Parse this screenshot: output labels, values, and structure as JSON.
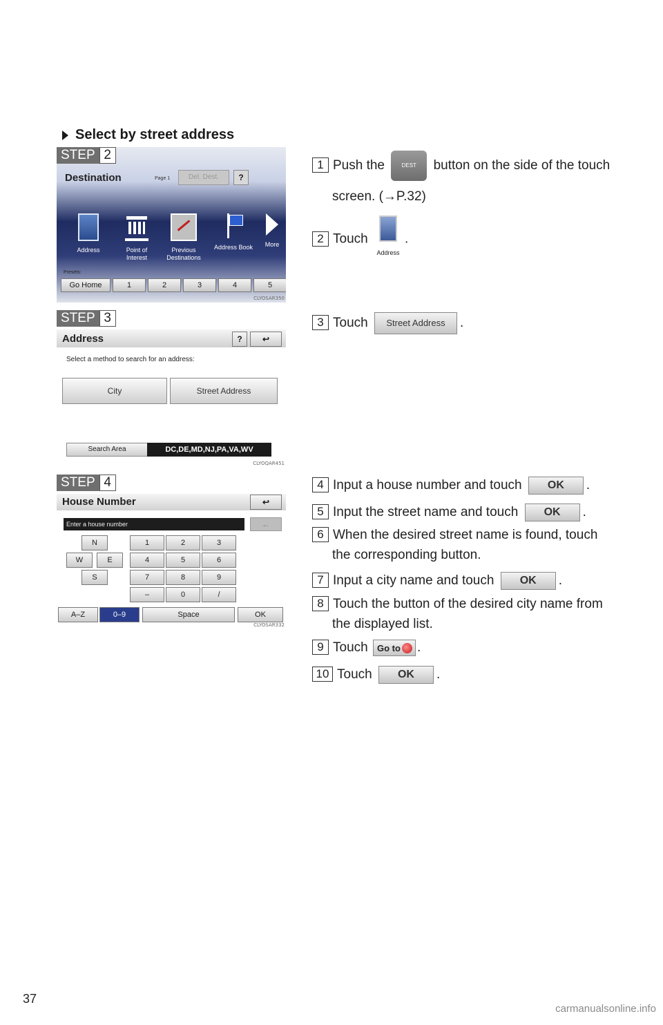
{
  "section_heading": "Select by street address",
  "steps": [
    {
      "step_word": "STEP",
      "step_num": "2"
    },
    {
      "step_word": "STEP",
      "step_num": "3"
    },
    {
      "step_word": "STEP",
      "step_num": "4"
    }
  ],
  "screen_destination": {
    "title": "Destination",
    "page": "Page 1",
    "del_dest": "Del. Dest.",
    "help": "?",
    "icons": [
      {
        "name": "address-icon",
        "label": "Address"
      },
      {
        "name": "poi-icon",
        "label": "Point of Interest"
      },
      {
        "name": "previous-icon",
        "label": "Previous Destinations"
      },
      {
        "name": "address-book-icon",
        "label": "Address Book"
      },
      {
        "name": "more-arrow-icon",
        "label": "More"
      }
    ],
    "presets_label": "Presets:",
    "presets": [
      "Go Home",
      "1",
      "2",
      "3",
      "4",
      "5"
    ],
    "code": "CLYOSAR350"
  },
  "screen_address": {
    "title": "Address",
    "help": "?",
    "back": "↩",
    "prompt": "Select a method to search for an address:",
    "city_btn": "City",
    "street_btn": "Street Address",
    "search_area_btn": "Search Area",
    "search_area_value": "DC,DE,MD,NJ,PA,VA,WV",
    "code": "CLYOQAR451"
  },
  "screen_house": {
    "title": "House Number",
    "back": "↩",
    "input_placeholder": "Enter a house number",
    "backspace": "←",
    "dir_keys": [
      "N",
      "W",
      "E",
      "S"
    ],
    "num_keys": [
      "1",
      "2",
      "3",
      "4",
      "5",
      "6",
      "7",
      "8",
      "9",
      "–",
      "0",
      "/"
    ],
    "bottom_keys": [
      "A–Z",
      "0–9",
      "Space",
      "OK"
    ],
    "code": "CLYOSAR332"
  },
  "instructions": {
    "i1_a": "Push the",
    "i1_dest": "DEST",
    "i1_b": "button on the side of the touch",
    "i1_c": "screen. (→P.32)",
    "i2_a": "Touch",
    "i2_icon_label": "Address",
    "i2_b": ".",
    "i3_a": "Touch",
    "i3_btn": "Street Address",
    "i3_b": ".",
    "i4_a": "Input a house number and touch",
    "i4_b": ".",
    "i5_a": "Input the street name and touch",
    "i5_b": ".",
    "i6_a": "When the desired street name is found, touch",
    "i6_b": "the corresponding button.",
    "i7_a": "Input a city name and touch",
    "i7_b": ".",
    "i8_a": "Touch the button of the desired city name from",
    "i8_b": "the displayed list.",
    "i9_a": "Touch",
    "i9_btn": "Go to",
    "i9_b": ".",
    "i10_a": "Touch",
    "i10_b": ".",
    "ok": "OK",
    "nums": [
      "1",
      "2",
      "3",
      "4",
      "5",
      "6",
      "7",
      "8",
      "9",
      "10"
    ]
  },
  "page_number": "37",
  "watermark": "carmanualsonline.info"
}
